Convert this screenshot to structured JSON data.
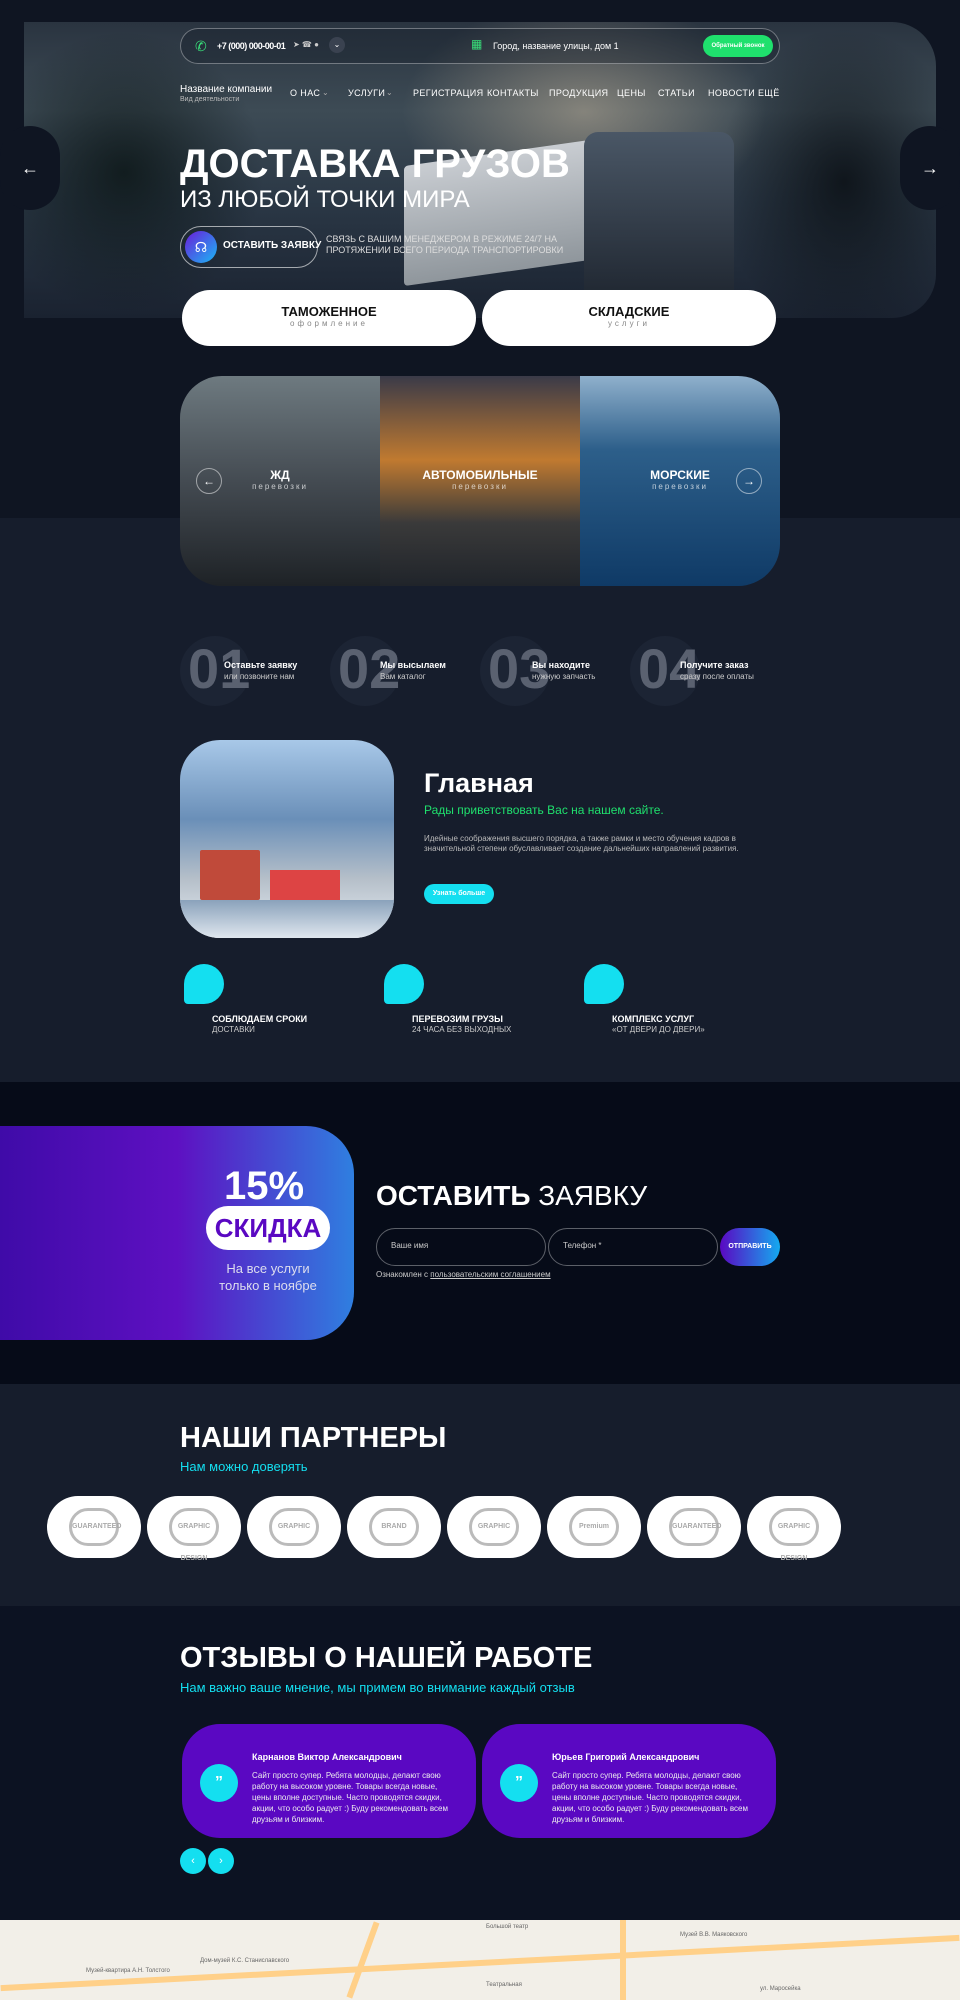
{
  "topbar": {
    "phone": "+7 (000) 000-00-01",
    "address": "Город, название улицы, дом 1",
    "callback_label": "Обратный звонок"
  },
  "brand": {
    "name": "Название компании",
    "tagline": "Вид деятельности"
  },
  "nav": [
    "О НАС",
    "УСЛУГИ",
    "РЕГИСТРАЦИЯ",
    "КОНТАКТЫ",
    "ПРОДУКЦИЯ",
    "ЦЕНЫ",
    "СТАТЬИ",
    "НОВОСТИ",
    "ЕЩЁ"
  ],
  "hero": {
    "title": "ДОСТАВКА ГРУЗОВ",
    "subtitle": "ИЗ ЛЮБОЙ ТОЧКИ МИРА",
    "cta": "ОСТАВИТЬ ЗАЯВКУ",
    "note_line1": "СВЯЗЬ С ВАШИМ МЕНЕДЖЕРОМ В РЕЖИМЕ 24/7 НА",
    "note_line2": "ПРОТЯЖЕНИИ ВСЕГО ПЕРИОДА ТРАНСПОРТИРОВКИ"
  },
  "cards": [
    {
      "title": "ТАМОЖЕННОЕ",
      "sub": "оформление"
    },
    {
      "title": "СКЛАДСКИЕ",
      "sub": "услуги"
    }
  ],
  "transport": [
    {
      "title": "ЖД",
      "sub": "перевозки"
    },
    {
      "title": "АВТОМОБИЛЬНЫЕ",
      "sub": "перевозки"
    },
    {
      "title": "МОРСКИЕ",
      "sub": "перевозки"
    }
  ],
  "steps": [
    {
      "num": "01",
      "title": "Оставьте заявку",
      "sub": "или позвоните нам"
    },
    {
      "num": "02",
      "title": "Мы высылаем",
      "sub": "Вам каталог"
    },
    {
      "num": "03",
      "title": "Вы находите",
      "sub": "нужную запчасть"
    },
    {
      "num": "04",
      "title": "Получите заказ",
      "sub": "сразу после оплаты"
    }
  ],
  "main": {
    "title": "Главная",
    "lead": "Рады приветствовать Вас на нашем сайте.",
    "body": "Идейные соображения высшего порядка, а также рамки и место обучения кадров в значительной степени обуславливает создание дальнейших направлений развития.",
    "button": "Узнать больше"
  },
  "features": [
    {
      "title": "СОБЛЮДАЕМ СРОКИ",
      "sub": "ДОСТАВКИ"
    },
    {
      "title": "ПЕРЕВОЗИМ ГРУЗЫ",
      "sub": "24 ЧАСА БЕЗ ВЫХОДНЫХ"
    },
    {
      "title": "КОМПЛЕКС УСЛУГ",
      "sub": "«ОТ ДВЕРИ ДО ДВЕРИ»"
    }
  ],
  "offer": {
    "percent": "15%",
    "badge": "СКИДКА",
    "note_line1": "На все услуги",
    "note_line2": "только в ноябре",
    "form_title_bold": "ОСТАВИТЬ",
    "form_title_light": "ЗАЯВКУ",
    "name_placeholder": "Ваше имя",
    "phone_placeholder": "Телефон *",
    "submit": "ОТПРАВИТЬ",
    "consent": "Ознакомлен с",
    "consent_link": "пользовательским соглашением"
  },
  "partners": {
    "title": "НАШИ ПАРТНЕРЫ",
    "sub": "Нам можно доверять",
    "logos": [
      "GUARANTEED",
      "GRAPHIC DESIGN",
      "GRAPHIC",
      "BRAND",
      "GRAPHIC",
      "Premium",
      "GUARANTEED",
      "GRAPHIC DESIGN"
    ]
  },
  "reviews": {
    "title": "ОТЗЫВЫ О НАШЕЙ РАБОТЕ",
    "sub": "Нам важно ваше мнение, мы примем во внимание каждый отзыв",
    "items": [
      {
        "name": "Карнанов Виктор Александрович",
        "text": "Сайт просто супер. Ребята молодцы, делают свою работу на высоком уровне. Товары всегда новые, цены вполне доступные. Часто проводятся скидки, акции, что особо радует :) Буду рекомендовать всем друзьям и близким."
      },
      {
        "name": "Юрьев Григорий Александрович",
        "text": "Сайт просто супер. Ребята молодцы, делают свою работу на высоком уровне. Товары всегда новые, цены вполне доступные. Часто проводятся скидки, акции, что особо радует :) Буду рекомендовать всем друзьям и близким."
      }
    ]
  },
  "map": {
    "labels": [
      "Музей В.В. Маяковского",
      "Большой театр",
      "ул. Маросейка",
      "Театральная",
      "Музей-квартира А.Н. Толстого",
      "Дом-музей К.С. Станиславского"
    ]
  },
  "colors": {
    "accent_green": "#1fe06d",
    "accent_cyan": "#14dff0",
    "accent_purple": "#5a08c2",
    "bg_dark": "#161d2c"
  }
}
